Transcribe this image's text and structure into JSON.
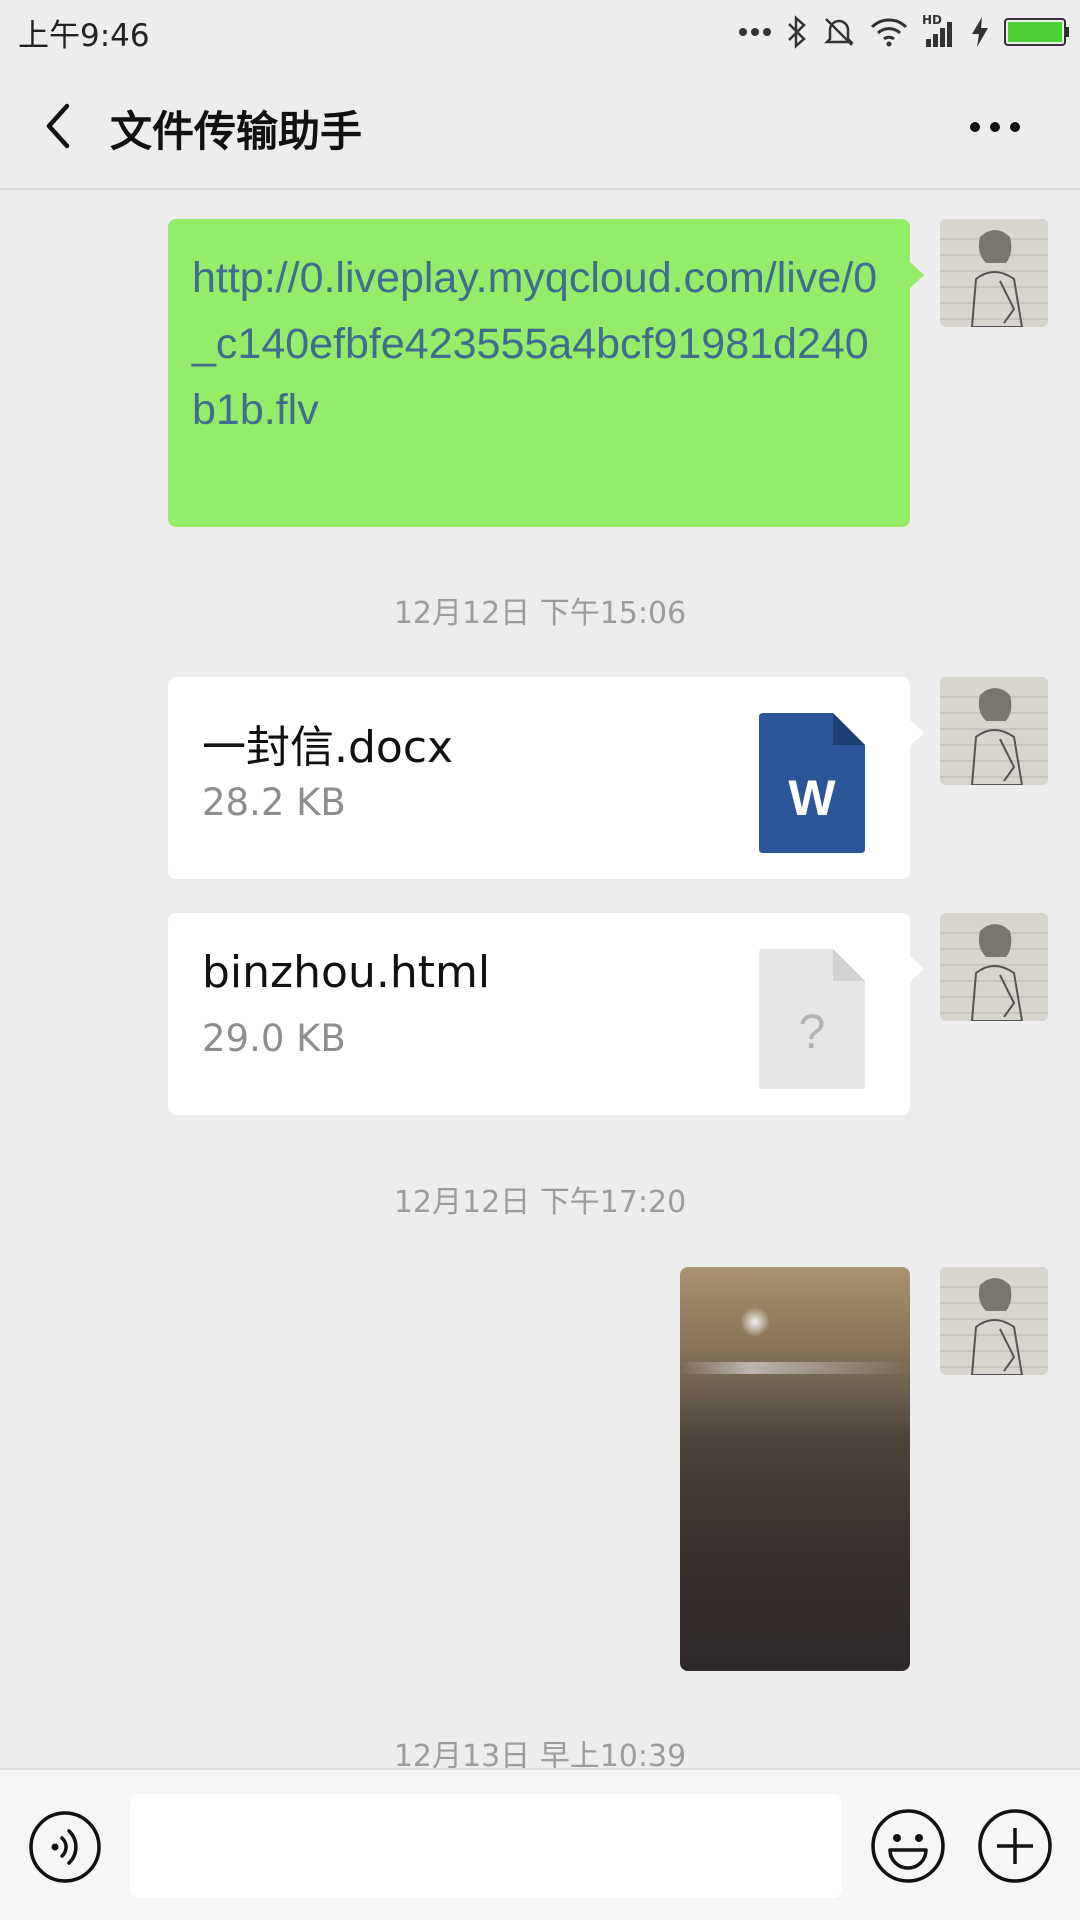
{
  "status_bar": {
    "time": "上午9:46",
    "icons": [
      "more-dots-icon",
      "bluetooth-icon",
      "silent-icon",
      "wifi-icon",
      "hd-signal-icon",
      "charging-icon",
      "battery-icon"
    ],
    "hd_label": "HD",
    "battery_color": "#4cd137"
  },
  "header": {
    "title": "文件传输助手",
    "back_icon": "chevron-left-icon",
    "more_icon": "more-icon"
  },
  "messages": [
    {
      "type": "text",
      "text": "http://0.liveplay.myqcloud.com/live/0_c140efbfe423555a4bcf91981d240b1b.flv",
      "bubble_color": "#95ec69"
    },
    {
      "type": "timestamp",
      "text": "12月12日 下午15:06"
    },
    {
      "type": "file",
      "name": "一封信.docx",
      "size": "28.2 KB",
      "icon": "word-file-icon",
      "icon_letter": "W",
      "icon_color": "#2b579a"
    },
    {
      "type": "file",
      "name": "binzhou.html",
      "size": "29.0 KB",
      "icon": "unknown-file-icon",
      "icon_letter": "?",
      "icon_color": "#e6e6e6"
    },
    {
      "type": "timestamp",
      "text": "12月12日 下午17:20"
    },
    {
      "type": "image",
      "description_icon": "photo-thumbnail"
    },
    {
      "type": "timestamp",
      "text": "12月13日 早上10:39"
    }
  ],
  "input_bar": {
    "voice_icon": "voice-icon",
    "input_value": "",
    "emoji_icon": "emoji-icon",
    "plus_icon": "plus-icon"
  }
}
